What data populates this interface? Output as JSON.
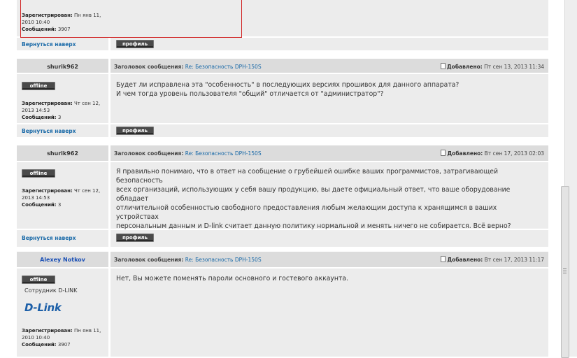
{
  "prev_post": {
    "registered_label": "Зарегистрирован:",
    "registered_value": "Пн янв 11, 2010 10:40",
    "messages_label": "Сообщений:",
    "messages_value": "3907",
    "back_top": "Вернуться наверх",
    "profile": "профиль"
  },
  "posts": [
    {
      "author": "shurik962",
      "subject_label": "Заголовок сообщения:",
      "subject": "Re: Безопасность DPH-150S",
      "posted_label": "Добавлено:",
      "posted": "Пт сен 13, 2013 11:34",
      "status": "offline",
      "registered_label": "Зарегистрирован:",
      "registered_value": "Чт сен 12, 2013 14:53",
      "messages_label": "Сообщений:",
      "messages_value": "3",
      "message_lines": [
        "Будет ли исправлена эта \"особенность\" в последующих версиях прошивок для данного аппарата?",
        "И чем тогда уровень пользователя \"общий\" отличается от \"администратор\"?"
      ],
      "back_top": "Вернуться наверх",
      "profile": "профиль"
    },
    {
      "author": "shurik962",
      "subject_label": "Заголовок сообщения:",
      "subject": "Re: Безопасность DPH-150S",
      "posted_label": "Добавлено:",
      "posted": "Вт сен 17, 2013 02:03",
      "status": "offline",
      "registered_label": "Зарегистрирован:",
      "registered_value": "Чт сен 12, 2013 14:53",
      "messages_label": "Сообщений:",
      "messages_value": "3",
      "message_lines": [
        "Я правильно понимаю, что в ответ на сообщение о грубейшей ошибке ваших программистов, затрагивающей безопасность",
        "всех организаций, использующих у себя вашу продукцию, вы даете официальный ответ, что ваше оборудование обладает",
        "отличительной особенностью свободного предоставления любым желающим доступа к хранящимся в ваших устройствах",
        "персональным данным и D-link считает данную политику нормальной и менять ничего не собирается. Всё верно?"
      ],
      "back_top": "Вернуться наверх",
      "profile": "профиль"
    },
    {
      "author": "Alexey Notkov",
      "subject_label": "Заголовок сообщения:",
      "subject": "Re: Безопасность DPH-150S",
      "posted_label": "Добавлено:",
      "posted": "Вт сен 17, 2013 11:17",
      "status": "offline",
      "role": "Сотрудник D-LINK",
      "logo": "D-Link",
      "registered_label": "Зарегистрирован:",
      "registered_value": "Пн янв 11, 2010 10:40",
      "messages_label": "Сообщений:",
      "messages_value": "3907",
      "message_lines": [
        "Нет, Вы можете поменять пароли основного и гостевого аккаунта."
      ]
    }
  ]
}
